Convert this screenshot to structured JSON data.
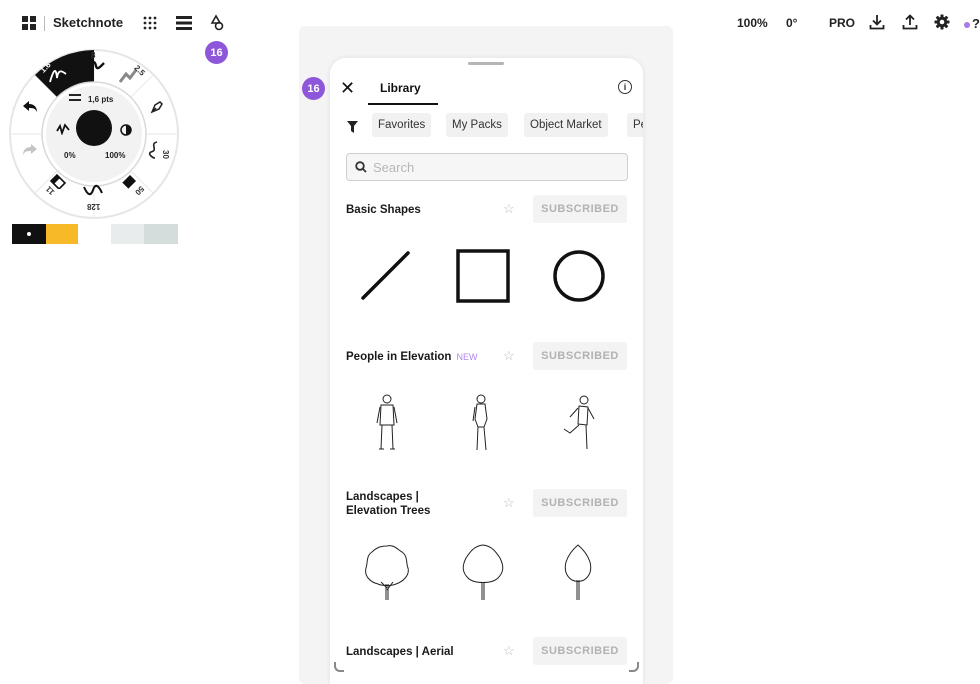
{
  "toolbar": {
    "app_title": "Sketchnote",
    "badge_top": "16",
    "badge_panel": "16"
  },
  "top_right": {
    "zoom": "100%",
    "rotation": "0°",
    "pro": "PRO",
    "help": "?"
  },
  "tool_wheel": {
    "brush_size_top": "1.6",
    "pen_size": "8",
    "pencil_size": "2.5",
    "stroke_label": "1,6 pts",
    "opacity_min": "0%",
    "opacity_max": "100%",
    "right_size": "30",
    "bottom_size": "128",
    "eraser_size": "50",
    "left_size": "11"
  },
  "colors": {
    "accent": "#8e57d9",
    "swatch_black": "#111111",
    "swatch_yellow": "#f7b928",
    "swatch_light1": "#e8ecec",
    "swatch_light2": "#d4dcdc"
  },
  "library": {
    "tab_label": "Library",
    "chips": [
      "Favorites",
      "My Packs",
      "Object Market",
      "Pe"
    ],
    "search_placeholder": "Search",
    "sections": [
      {
        "title": "Basic Shapes",
        "tag": "",
        "button": "SUBSCRIBED"
      },
      {
        "title": "People in Elevation",
        "tag": "NEW",
        "button": "SUBSCRIBED"
      },
      {
        "title_line1": "Landscapes |",
        "title_line2": "Elevation Trees",
        "button": "SUBSCRIBED"
      },
      {
        "title": "Landscapes | Aerial",
        "button": "SUBSCRIBED"
      }
    ]
  }
}
